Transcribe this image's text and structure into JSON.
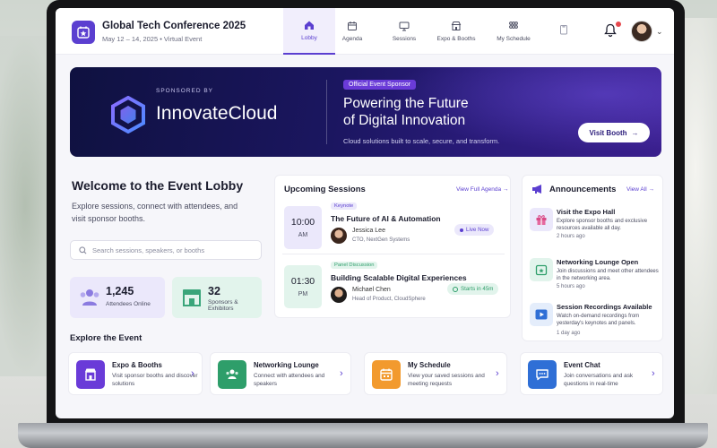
{
  "app": {
    "title": "Global Tech Conference 2025",
    "subtitle": "May 12 – 14, 2025 • Virtual Event"
  },
  "nav": {
    "tabs": [
      {
        "label": "Lobby",
        "icon": "home-icon",
        "active": true
      },
      {
        "label": "Agenda",
        "icon": "calendar-icon"
      },
      {
        "label": "Sessions",
        "icon": "presentation-icon"
      },
      {
        "label": "Expo & Booths",
        "icon": "booth-icon"
      },
      {
        "label": "My Schedule",
        "icon": "grid-icon"
      },
      {
        "label": "",
        "icon": "badge-icon"
      }
    ]
  },
  "hero": {
    "sponsored_by": "SPONSORED BY",
    "brand": "InnovateCloud",
    "pill": "Official Event Sponsor",
    "headline_1": "Powering the Future",
    "headline_2": "of Digital Innovation",
    "subtext": "Cloud solutions built to scale, secure, and transform.",
    "cta": "Visit Booth",
    "cta_arrow": "→"
  },
  "welcome": {
    "title": "Welcome to the Event Lobby",
    "subtitle": "Explore sessions, connect with attendees, and visit sponsor booths."
  },
  "search": {
    "placeholder": "Search sessions, speakers, or booths"
  },
  "stats": {
    "attendees": {
      "value": "1,245",
      "label": "Attendees Online"
    },
    "sponsors": {
      "value": "32",
      "label_1": "Sponsors &",
      "label_2": "Exhibitors"
    }
  },
  "sessions": {
    "title": "Upcoming Sessions",
    "link": "View Full Agenda →",
    "items": [
      {
        "time": "10:00",
        "ampm": "AM",
        "tag": "Keynote",
        "title": "The Future of AI & Automation",
        "speaker": "Jessica Lee",
        "role": "CTO, NextGen Systems",
        "status": "Live Now"
      },
      {
        "time": "01:30",
        "ampm": "PM",
        "tag": "Panel Discussion",
        "title": "Building Scalable Digital Experiences",
        "speaker": "Michael Chen",
        "role": "Head of Product, CloudSphere",
        "status": "Starts in 45m"
      }
    ]
  },
  "announcements": {
    "title": "Announcements",
    "link": "View All →",
    "items": [
      {
        "title": "Visit the Expo Hall",
        "desc": "Explore sponsor booths and exclusive resources available all day.",
        "time": "2 hours ago"
      },
      {
        "title": "Networking Lounge Open",
        "desc": "Join discussions and meet other attendees in the networking area.",
        "time": "5 hours ago"
      },
      {
        "title": "Session Recordings Available",
        "desc": "Watch on-demand recordings from yesterday's keynotes and panels.",
        "time": "1 day ago"
      }
    ]
  },
  "explore": {
    "title": "Explore the Event",
    "items": [
      {
        "title": "Expo & Booths",
        "desc": "Visit sponsor booths and discover solutions",
        "color": "#6a3bd8"
      },
      {
        "title": "Networking Lounge",
        "desc": "Connect with attendees and speakers",
        "color": "#2e9e6a"
      },
      {
        "title": "My Schedule",
        "desc": "View your saved sessions and meeting requests",
        "color": "#f29a2e"
      },
      {
        "title": "Event Chat",
        "desc": "Join conversations and ask questions in real-time",
        "color": "#2f6fd6"
      }
    ]
  },
  "colors": {
    "accent": "#5b3fd0",
    "live": "#5b3fd0",
    "starts": "#2e9e6a"
  }
}
